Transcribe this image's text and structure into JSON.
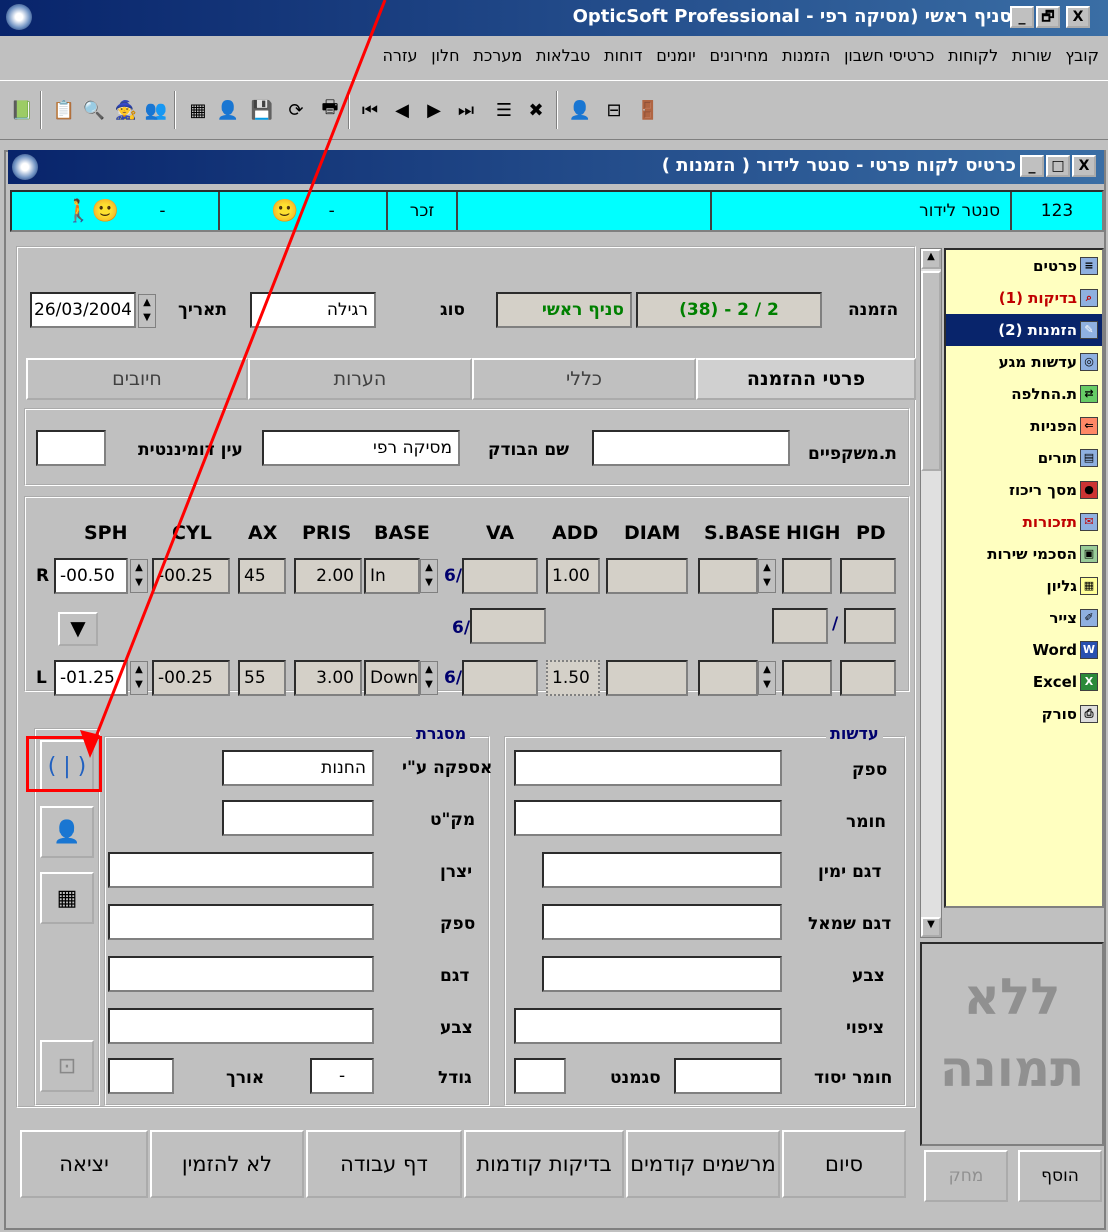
{
  "app": {
    "title": "(סניף ראשי (מסיקה רפי - OpticSoft Professional",
    "min_btn": "_",
    "max_btn": "🗗",
    "close_btn": "X"
  },
  "menu": [
    "קובץ",
    "שורות",
    "לקוחות",
    "כרטיסי חשבון",
    "הזמנות",
    "מחירונים",
    "יומנים",
    "דוחות",
    "טבלאות",
    "מערכת",
    "חלון",
    "עזרה"
  ],
  "child": {
    "title": "כרטיס לקוח פרטי - סנטר לידור ( הזמנות )"
  },
  "header": {
    "id": "123",
    "name": "סנטר לידור",
    "gender": "זכר",
    "dash1": "-",
    "dash2": "-"
  },
  "order": {
    "label": "הזמנה",
    "number": "(38) - 2 / 2",
    "branch": "סניף ראשי",
    "type_label": "סוג",
    "type_value": "רגילה",
    "date_label": "תאריך",
    "date_value": "26/03/2004"
  },
  "tabs": [
    "פרטי ההזמנה",
    "כללי",
    "הערות",
    "חיובים"
  ],
  "exam": {
    "glasses_label": "ת.משקפיים",
    "glasses_value": "",
    "examiner_label": "שם הבודק",
    "examiner_value": "מסיקה רפי",
    "dominant_label": "עין דומיננטית",
    "dominant_value": ""
  },
  "rx": {
    "headers": [
      "SPH",
      "CYL",
      "AX",
      "PRIS",
      "BASE",
      "VA",
      "ADD",
      "DIAM",
      "S.BASE",
      "HIGH",
      "PD"
    ],
    "r_label": "R",
    "l_label": "L",
    "six": "6/",
    "slash": "/",
    "right": {
      "sph": "-00.50",
      "cyl": "-00.25",
      "ax": "45",
      "pris": "2.00",
      "base": "In",
      "add": "1.00"
    },
    "left": {
      "sph": "-01.25",
      "cyl": "-00.25",
      "ax": "55",
      "pris": "3.00",
      "base": "Down",
      "add": "1.50"
    }
  },
  "frame": {
    "title": "מסגרת",
    "supplied_by_label": "אספקה ע\"י",
    "supplied_by_value": "החנות",
    "sku_label": "מק\"ט",
    "maker_label": "יצרן",
    "supplier_label": "ספק",
    "model_label": "דגם",
    "color_label": "צבע",
    "size_label": "גודל",
    "size_value": "-",
    "length_label": "אורך"
  },
  "lenses": {
    "title": "עדשות",
    "supplier_label": "ספק",
    "material_label": "חומר",
    "model_right_label": "דגם ימין",
    "model_left_label": "דגם שמאל",
    "color_label": "צבע",
    "coating_label": "ציפוי",
    "base_material_label": "חומר יסוד",
    "segment_label": "סגמנט"
  },
  "tree": [
    {
      "label": "פרטים",
      "color": "#000000"
    },
    {
      "label": "בדיקות (1)",
      "color": "#c00000"
    },
    {
      "label": "הזמנות (2)",
      "color": "#ffffff"
    },
    {
      "label": "עדשות מגע",
      "color": "#000000"
    },
    {
      "label": "ת.החלפה",
      "color": "#000000"
    },
    {
      "label": "הפניות",
      "color": "#000000"
    },
    {
      "label": "תורים",
      "color": "#000000"
    },
    {
      "label": "מסך ריכוז",
      "color": "#000000"
    },
    {
      "label": "תזכורות",
      "color": "#c00000"
    },
    {
      "label": "הסכמי שירות",
      "color": "#000000"
    },
    {
      "label": "גליון",
      "color": "#000000"
    },
    {
      "label": "צייר",
      "color": "#000000"
    },
    {
      "label": "Word",
      "color": "#000000"
    },
    {
      "label": "Excel",
      "color": "#000000"
    },
    {
      "label": "סורק",
      "color": "#000000"
    }
  ],
  "photo": {
    "line1": "ללא",
    "line2": "תמונה",
    "add": "הוסף",
    "delete": "מחק"
  },
  "bottom": [
    "סיום",
    "מרשמים קודמים",
    "בדיקות קודמות",
    "דף עבודה",
    "לא להזמין",
    "יציאה"
  ],
  "accent": {
    "title": "#08246b",
    "cyan": "#00ffff",
    "arrow": "#ff0000"
  }
}
